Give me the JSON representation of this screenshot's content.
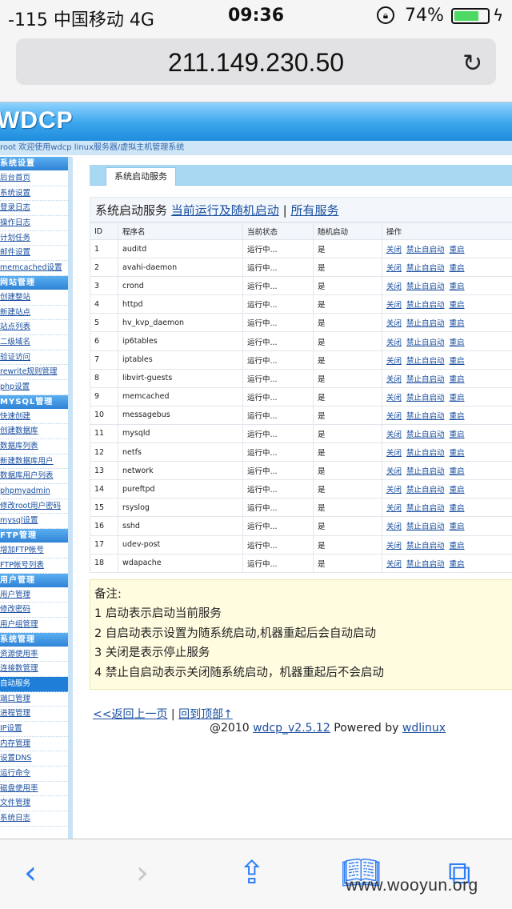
{
  "status_bar": {
    "carrier": "-115 中国移动 4G",
    "time": "09:36",
    "battery": "74%",
    "battery_level": 0.74
  },
  "browser": {
    "url": "211.149.230.50"
  },
  "site": {
    "logo": "WDCP",
    "welcome": "root 欢迎使用wdcp linux服务器/虚拟主机管理系统",
    "sidebar": [
      {
        "group": "系统设置",
        "items": [
          "后台首页",
          "系统设置",
          "登录日志",
          "操作日志",
          "计划任务",
          "邮件设置",
          "memcached设置"
        ]
      },
      {
        "group": "网站管理",
        "items": [
          "创建整站",
          "新建站点",
          "站点列表",
          "二级域名",
          "验证访问",
          "rewrite规则管理",
          "php设置"
        ]
      },
      {
        "group": "MYSQL管理",
        "items": [
          "快速创建",
          "创建数据库",
          "数据库列表",
          "新建数据库用户",
          "数据库用户列表",
          "phpmyadmin",
          "修改root用户密码",
          "mysql设置"
        ]
      },
      {
        "group": "FTP管理",
        "items": [
          "增加FTP帐号",
          "FTP帐号列表"
        ]
      },
      {
        "group": "用户管理",
        "items": [
          "用户管理",
          "修改密码",
          "用户组管理"
        ]
      },
      {
        "group": "系统管理",
        "items": [
          "资源使用率",
          "连接数管理",
          "自动服务",
          "端口管理",
          "进程管理",
          "IP设置",
          "内存管理",
          "设置DNS",
          "运行命令",
          "磁盘使用率",
          "文件管理",
          "系统日志"
        ]
      }
    ],
    "active_item": "自动服务",
    "tab": "系统启动服务",
    "heading": {
      "title": "系统启动服务",
      "link1": "当前运行及随机启动",
      "sep": "|",
      "link2": "所有服务"
    },
    "table": {
      "columns": [
        "ID",
        "程序名",
        "当前状态",
        "随机启动",
        "操作"
      ],
      "rows": [
        [
          "1",
          "auditd",
          "运行中...",
          "是"
        ],
        [
          "2",
          "avahi-daemon",
          "运行中...",
          "是"
        ],
        [
          "3",
          "crond",
          "运行中...",
          "是"
        ],
        [
          "4",
          "httpd",
          "运行中...",
          "是"
        ],
        [
          "5",
          "hv_kvp_daemon",
          "运行中...",
          "是"
        ],
        [
          "6",
          "ip6tables",
          "运行中...",
          "是"
        ],
        [
          "7",
          "iptables",
          "运行中...",
          "是"
        ],
        [
          "8",
          "libvirt-guests",
          "运行中...",
          "是"
        ],
        [
          "9",
          "memcached",
          "运行中...",
          "是"
        ],
        [
          "10",
          "messagebus",
          "运行中...",
          "是"
        ],
        [
          "11",
          "mysqld",
          "运行中...",
          "是"
        ],
        [
          "12",
          "netfs",
          "运行中...",
          "是"
        ],
        [
          "13",
          "network",
          "运行中...",
          "是"
        ],
        [
          "14",
          "pureftpd",
          "运行中...",
          "是"
        ],
        [
          "15",
          "rsyslog",
          "运行中...",
          "是"
        ],
        [
          "16",
          "sshd",
          "运行中...",
          "是"
        ],
        [
          "17",
          "udev-post",
          "运行中...",
          "是"
        ],
        [
          "18",
          "wdapache",
          "运行中...",
          "是"
        ]
      ],
      "actions": [
        "关闭",
        "禁止自启动",
        "重启"
      ]
    },
    "notes": [
      "备注:",
      "1 启动表示启动当前服务",
      "2 自启动表示设置为随系统启动,机器重起后会自动启动",
      "3 关闭是表示停止服务",
      "4 禁止自启动表示关闭随系统启动，机器重起后不会启动"
    ],
    "footer": {
      "back": "<<返回上一页",
      "sep": "|",
      "top": "回到顶部↑",
      "copy": "@2010",
      "version": "wdcp_v2.5.12",
      "powered": "Powered by",
      "brand": "wdlinux"
    }
  },
  "watermark": "www.wooyun.org",
  "toolbar_icons": [
    "back-icon",
    "forward-icon",
    "share-icon",
    "bookmarks-icon",
    "tabs-icon"
  ]
}
